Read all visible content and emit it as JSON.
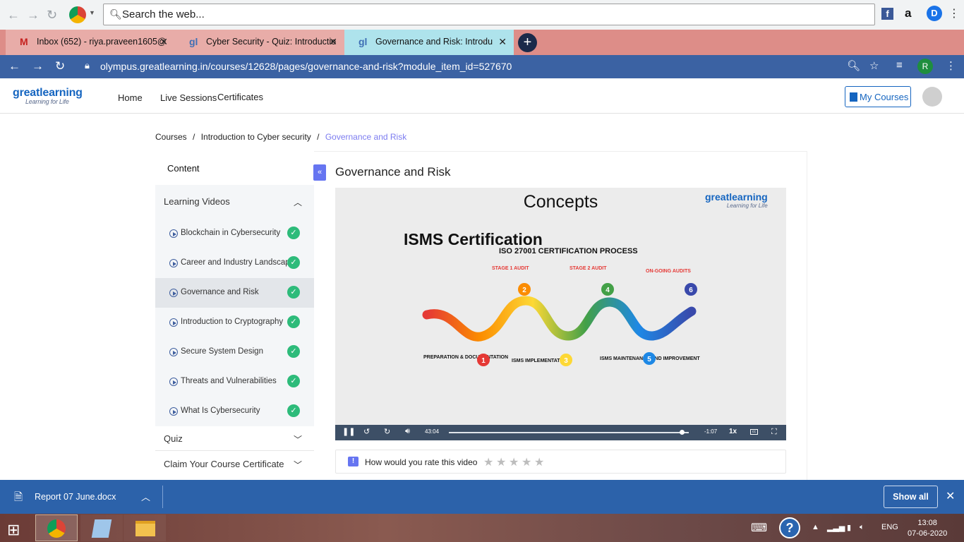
{
  "outer_bar": {
    "search_placeholder": "Search the web..."
  },
  "tabs": [
    {
      "title": "Inbox (652) - riya.praveen1605@",
      "icon": "M"
    },
    {
      "title": "Cyber Security - Quiz: Introductio",
      "icon": "gl"
    },
    {
      "title": "Governance and Risk: Introdu",
      "icon": "gl"
    }
  ],
  "omnibox": {
    "url": "olympus.greatlearning.in/courses/12628/pages/governance-and-risk?module_item_id=527670",
    "profile_initial": "R"
  },
  "site": {
    "logo": "greatlearning",
    "tagline": "Learning for Life",
    "nav": [
      "Home",
      "Live Sessions",
      "Certificates"
    ],
    "my_courses": "My Courses"
  },
  "breadcrumb": {
    "items": [
      "Courses",
      "Introduction to Cyber security",
      "Governance and Risk"
    ],
    "separator": "/"
  },
  "sidebar": {
    "heading": "Content",
    "section_learning_videos": "Learning Videos",
    "videos": [
      {
        "label": "Blockchain in Cybersecurity",
        "done": true
      },
      {
        "label": "Career and Industry Landscape",
        "done": true
      },
      {
        "label": "Governance and Risk",
        "done": true
      },
      {
        "label": "Introduction to Cryptography",
        "done": true
      },
      {
        "label": "Secure System Design",
        "done": true
      },
      {
        "label": "Threats and Vulnerabilities",
        "done": true
      },
      {
        "label": "What Is Cybersecurity",
        "done": true
      }
    ],
    "section_quiz": "Quiz",
    "section_certificate": "Claim Your Course Certificate"
  },
  "page_title": "Governance and Risk",
  "video": {
    "slide_title": "Concepts",
    "slide_logo": "greatlearning",
    "slide_tagline": "Learning for Life",
    "heading": "ISMS Certification",
    "subheading": "ISO 27001 CERTIFICATION PROCESS",
    "stage_labels": [
      "STAGE 1 AUDIT",
      "STAGE 2 AUDIT",
      "ON-GOING AUDITS"
    ],
    "step_labels": [
      "PREPARATION & DOCUMENTATION",
      "ISMS IMPLEMENTATION",
      "ISMS MAINTENANCE AND IMPROVEMENT"
    ],
    "step_numbers": [
      "1",
      "2",
      "3",
      "4",
      "5",
      "6"
    ],
    "elapsed": "43:04",
    "remaining": "-1:07",
    "speed": "1x",
    "progress_fraction": 0.97
  },
  "rating": {
    "question": "How would you rate this video",
    "stars": 5
  },
  "downloads": {
    "file": "Report 07 June.docx",
    "show_all": "Show all"
  },
  "taskbar": {
    "language": "ENG",
    "time": "13:08",
    "date": "07-06-2020"
  },
  "colors": {
    "accent": "#6675f1",
    "brand": "#1565c0",
    "check": "#2dbb7a",
    "download_bar": "#2c62aa"
  }
}
